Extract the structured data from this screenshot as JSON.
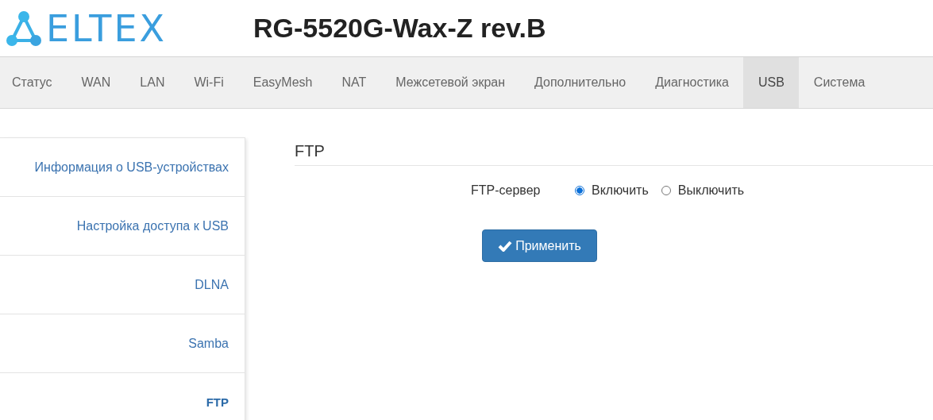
{
  "header": {
    "logo": "ELTEX",
    "title": "RG-5520G-Wax-Z rev.B"
  },
  "tabs": [
    {
      "label": "Статус",
      "selected": false
    },
    {
      "label": "WAN",
      "selected": false
    },
    {
      "label": "LAN",
      "selected": false
    },
    {
      "label": "Wi-Fi",
      "selected": false
    },
    {
      "label": "EasyMesh",
      "selected": false
    },
    {
      "label": "NAT",
      "selected": false
    },
    {
      "label": "Межсетевой экран",
      "selected": false
    },
    {
      "label": "Дополнительно",
      "selected": false
    },
    {
      "label": "Диагностика",
      "selected": false
    },
    {
      "label": "USB",
      "selected": true
    },
    {
      "label": "Система",
      "selected": false
    }
  ],
  "sidebar": {
    "items": [
      {
        "label": "Информация о USB-устройствах",
        "selected": false
      },
      {
        "label": "Настройка доступа к USB",
        "selected": false
      },
      {
        "label": "DLNA",
        "selected": false
      },
      {
        "label": "Samba",
        "selected": false
      },
      {
        "label": "FTP",
        "selected": true
      }
    ]
  },
  "section": {
    "title": "FTP",
    "field": {
      "label": "FTP-сервер",
      "options": [
        {
          "label": "Включить",
          "selected": true
        },
        {
          "label": "Выключить",
          "selected": false
        }
      ]
    },
    "apply_button": "Применить"
  }
}
